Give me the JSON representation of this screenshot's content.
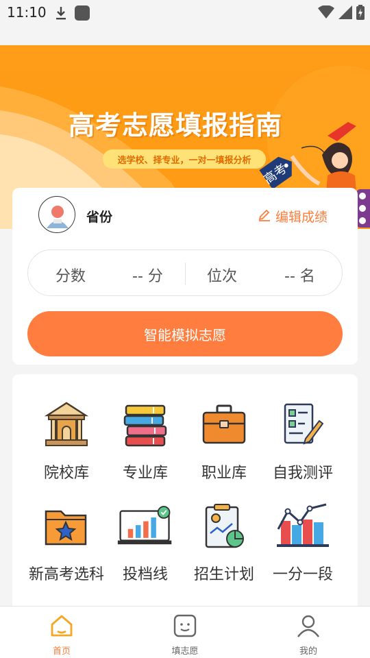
{
  "status_bar": {
    "time": "11:10"
  },
  "banner": {
    "title": "高考志愿填报指南",
    "subtitle": "选学校、择专业，一对一填报分析",
    "tag_text": "高考"
  },
  "score_card": {
    "province_label": "省份",
    "edit_label": "编辑成绩",
    "score_label": "分数",
    "score_value": "-- 分",
    "rank_label": "位次",
    "rank_value": "-- 名",
    "simulate_button": "智能模拟志愿"
  },
  "tools": [
    {
      "label": "院校库",
      "icon": "university-icon"
    },
    {
      "label": "专业库",
      "icon": "books-icon"
    },
    {
      "label": "职业库",
      "icon": "briefcase-icon"
    },
    {
      "label": "自我测评",
      "icon": "assessment-icon"
    },
    {
      "label": "新高考选科",
      "icon": "star-folder-icon"
    },
    {
      "label": "投档线",
      "icon": "bar-chart-icon"
    },
    {
      "label": "招生计划",
      "icon": "clipboard-chart-icon"
    },
    {
      "label": "一分一段",
      "icon": "line-chart-icon"
    }
  ],
  "bottom_nav": [
    {
      "label": "首页",
      "icon": "home-icon",
      "active": true
    },
    {
      "label": "填志愿",
      "icon": "fill-form-icon",
      "active": false
    },
    {
      "label": "我的",
      "icon": "profile-icon",
      "active": false
    }
  ],
  "colors": {
    "accent": "#ff7d3e",
    "banner": "#ff9d18"
  }
}
